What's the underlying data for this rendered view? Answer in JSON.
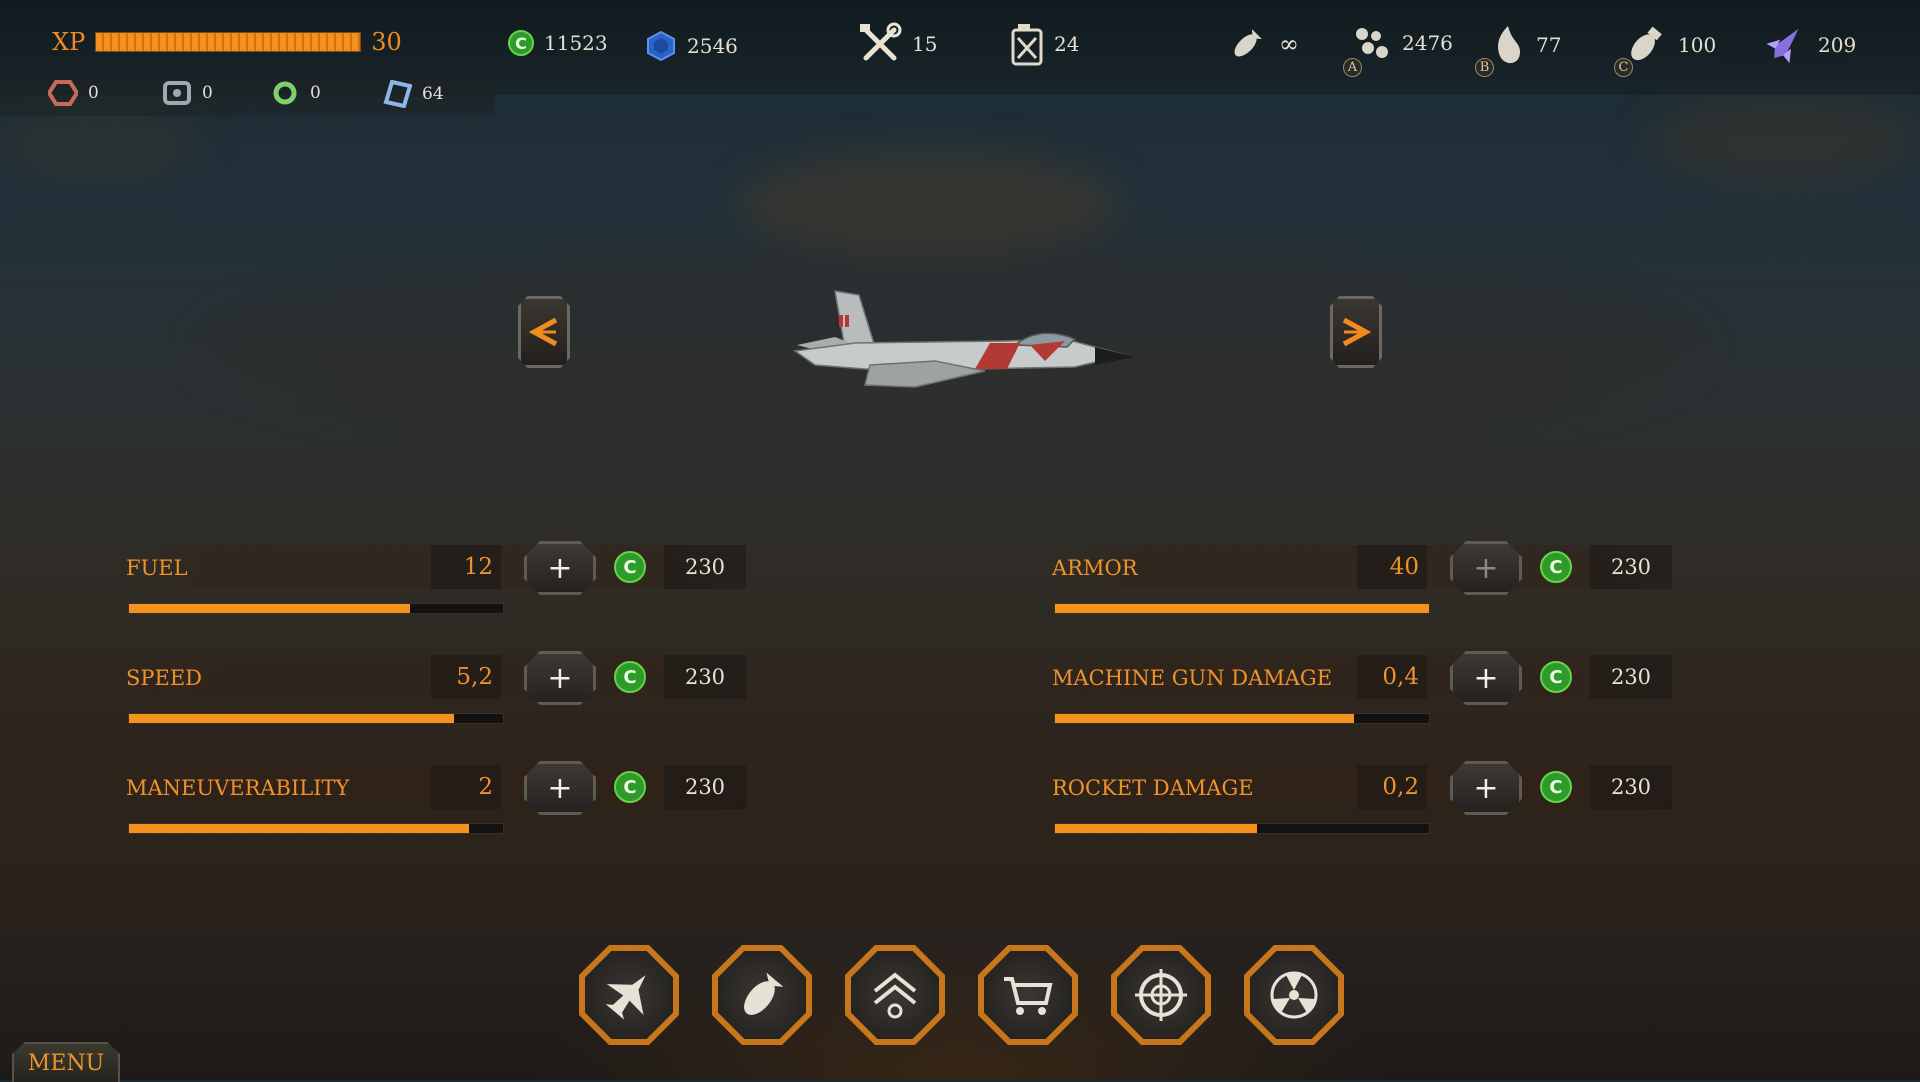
{
  "hud": {
    "xp_label": "XP",
    "xp_level": "30",
    "xp_progress": 1.0,
    "coins": "11523",
    "gems": "2546",
    "repair_kits": "15",
    "fuel_cans": "24",
    "weapons": [
      {
        "icon": "bomb-icon",
        "count": "∞",
        "badge": ""
      },
      {
        "icon": "cluster-bomb-icon",
        "count": "2476",
        "badge": "A"
      },
      {
        "icon": "napalm-icon",
        "count": "77",
        "badge": "B"
      },
      {
        "icon": "heavy-bomb-icon",
        "count": "100",
        "badge": "C"
      },
      {
        "icon": "special-missile-icon",
        "count": "209",
        "badge": ""
      }
    ],
    "parts": [
      {
        "icon": "red-hex-part-icon",
        "count": "0"
      },
      {
        "icon": "grey-gear-part-icon",
        "count": "0"
      },
      {
        "icon": "green-ring-part-icon",
        "count": "0"
      },
      {
        "icon": "blue-crystal-part-icon",
        "count": "64"
      }
    ]
  },
  "stats_left": [
    {
      "name": "FUEL",
      "value": "12",
      "level": 0.75,
      "price": "230"
    },
    {
      "name": "SPEED",
      "value": "5,2",
      "level": 0.87,
      "price": "230"
    },
    {
      "name": "MANEUVERABILITY",
      "value": "2",
      "level": 0.91,
      "price": "230"
    }
  ],
  "stats_right": [
    {
      "name": "ARMOR",
      "value": "40",
      "level": 1.0,
      "price": "230",
      "maxed": true
    },
    {
      "name": "MACHINE GUN DAMAGE",
      "value": "0,4",
      "level": 0.8,
      "price": "230"
    },
    {
      "name": "ROCKET DAMAGE",
      "value": "0,2",
      "level": 0.54,
      "price": "230"
    }
  ],
  "plus_label": "+",
  "coin_symbol": "C",
  "nav": [
    {
      "icon": "aircraft-icon"
    },
    {
      "icon": "bomb-weapons-icon"
    },
    {
      "icon": "rank-upgrade-icon"
    },
    {
      "icon": "shop-cart-icon"
    },
    {
      "icon": "target-crosshair-icon"
    },
    {
      "icon": "radiation-special-icon"
    }
  ],
  "menu_label": "MENU",
  "colors": {
    "accent": "#f0922a",
    "coin": "#2e9a2a"
  }
}
